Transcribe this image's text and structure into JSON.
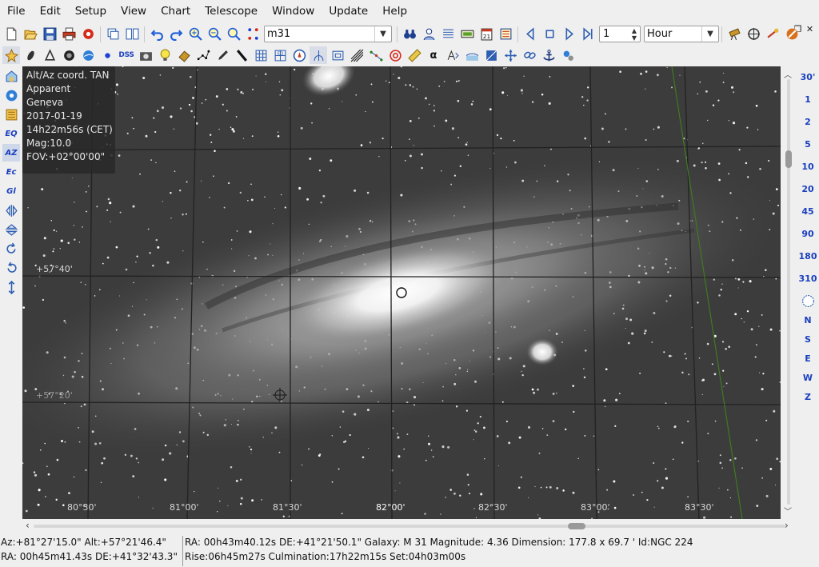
{
  "menu": [
    "File",
    "Edit",
    "Setup",
    "View",
    "Chart",
    "Telescope",
    "Window",
    "Update",
    "Help"
  ],
  "toolbar": {
    "search_value": "m31",
    "time_step_value": "1",
    "time_unit": "Hour",
    "dss_label": "DSS",
    "alpha_label": "α"
  },
  "left_toolbar": {
    "eq_label": "EQ",
    "az_label": "AZ",
    "ec_label": "Ec",
    "gl_label": "Gl"
  },
  "chart_info": {
    "projection": "Alt/Az coord. TAN",
    "mode": "Apparent",
    "location": "Geneva",
    "date": "2017-01-19",
    "time": "14h22m56s (CET)",
    "mag": "Mag:10.0",
    "fov": "FOV:+02°00'00\""
  },
  "grid_labels": {
    "alt1": "+57°40'",
    "alt2": "+57°20'",
    "az1": "80°30'",
    "az2": "81°00'",
    "az3": "81°30'",
    "az4": "82°00'",
    "az5": "82°30'",
    "az6": "83°00'",
    "az7": "83°30'"
  },
  "fov_buttons": [
    "30'",
    "1",
    "2",
    "5",
    "10",
    "20",
    "45",
    "90",
    "180",
    "310"
  ],
  "direction_buttons": [
    "N",
    "S",
    "E",
    "W",
    "Z"
  ],
  "status": {
    "cursor_azalt": "Az:+81°27'15.0\" Alt:+57°21'46.4\"",
    "cursor_radec": "RA: 00h45m41.43s DE:+41°32'43.3\"",
    "object_line": "RA: 00h43m40.12s DE:+41°21'50.1\"  Galaxy: M 31  Magnitude:  4.36  Dimension: 177.8 x 69.7 '  Id:NGC 224",
    "rise_line": "Rise:06h45m27s  Culmination:17h22m15s  Set:04h03m00s"
  },
  "colors": {
    "accent": "#1a3fbf",
    "sky_bg": "#3a3a3a",
    "grid": "#1f1f1f",
    "horizon_line": "#3f7a1f"
  }
}
